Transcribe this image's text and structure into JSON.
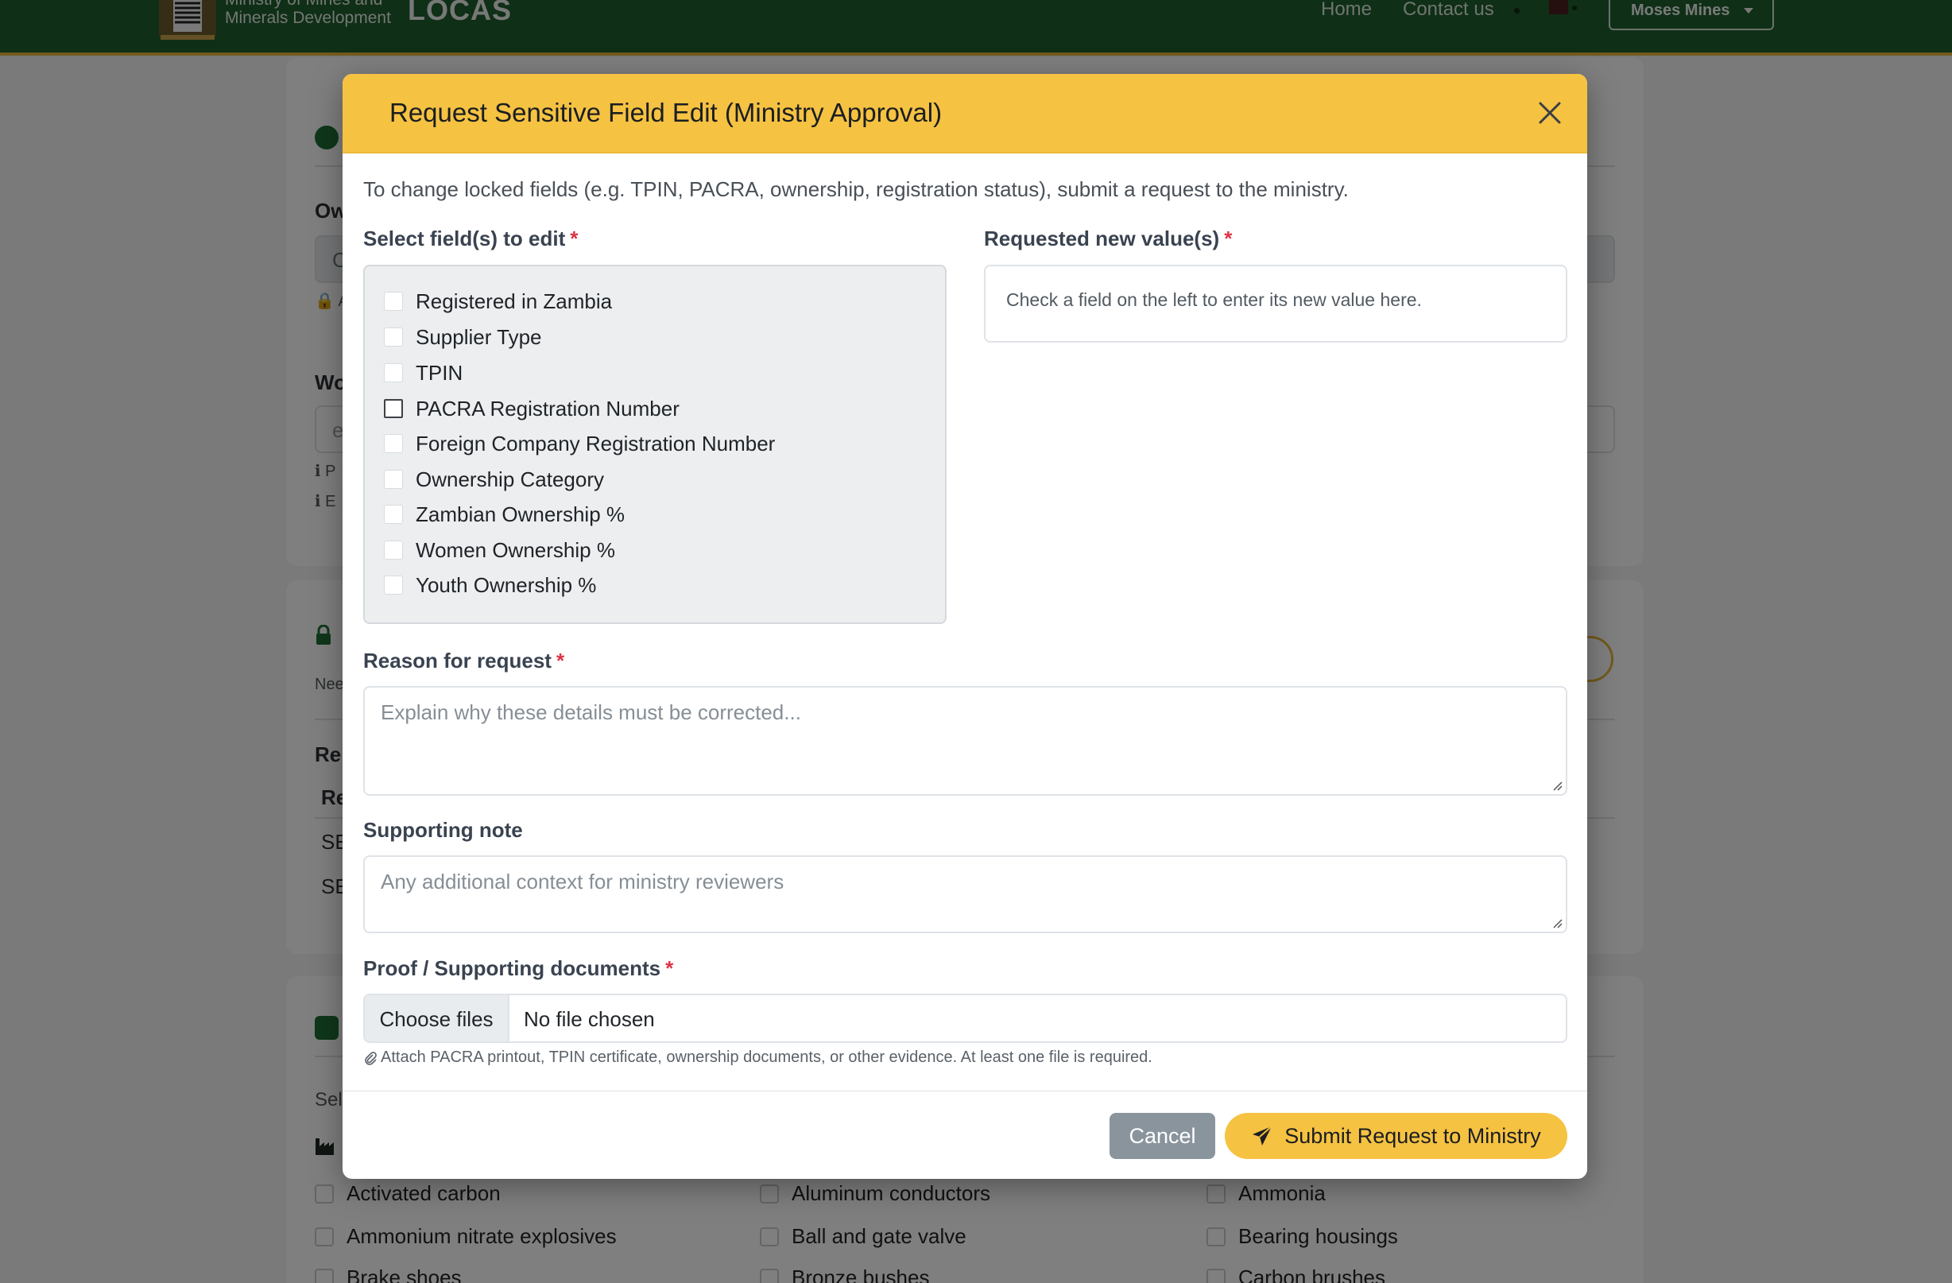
{
  "header": {
    "ministry_line1": "Ministry of Mines and",
    "ministry_line2": "Minerals Development",
    "brand": "LOCAS",
    "nav": [
      "Home",
      "Contact us"
    ],
    "user_menu": "Moses Mines"
  },
  "background": {
    "labels": [
      "Ow",
      "Wo",
      "Re"
    ],
    "partial_texts": [
      "C",
      "A",
      "e",
      "P",
      "E",
      "Nee",
      "Re",
      "SE",
      "SE",
      "Sel"
    ],
    "commodities": [
      "Activated carbon",
      "Aluminum conductors",
      "Ammonia",
      "Ammonium nitrate explosives",
      "Ball and gate valve",
      "Bearing housings",
      "Brake shoes",
      "Bronze bushes",
      "Carbon brushes"
    ]
  },
  "modal": {
    "title": "Request Sensitive Field Edit (Ministry Approval)",
    "intro": "To change locked fields (e.g. TPIN, PACRA, ownership, registration status), submit a request to the ministry.",
    "fields_label": "Select field(s) to edit",
    "required_mark": "*",
    "fields": [
      "Registered in Zambia",
      "Supplier Type",
      "TPIN",
      "PACRA Registration Number",
      "Foreign Company Registration Number",
      "Ownership Category",
      "Zambian Ownership %",
      "Women Ownership %",
      "Youth Ownership %"
    ],
    "values_label": "Requested new value(s)",
    "values_hint": "Check a field on the left to enter its new value here.",
    "reason_label": "Reason for request",
    "reason_placeholder": "Explain why these details must be corrected...",
    "note_label": "Supporting note",
    "note_placeholder": "Any additional context for ministry reviewers",
    "proof_label": "Proof / Supporting documents",
    "file_button": "Choose files",
    "file_status": "No file chosen",
    "file_help": "Attach PACRA printout, TPIN certificate, ownership documents, or other evidence. At least one file is required.",
    "cancel": "Cancel",
    "submit": "Submit Request to Ministry"
  },
  "colors": {
    "header_green": "#1f5f2f",
    "modal_header": "#f5c242",
    "required": "#dc3545",
    "cancel_grey": "#8a949d"
  }
}
